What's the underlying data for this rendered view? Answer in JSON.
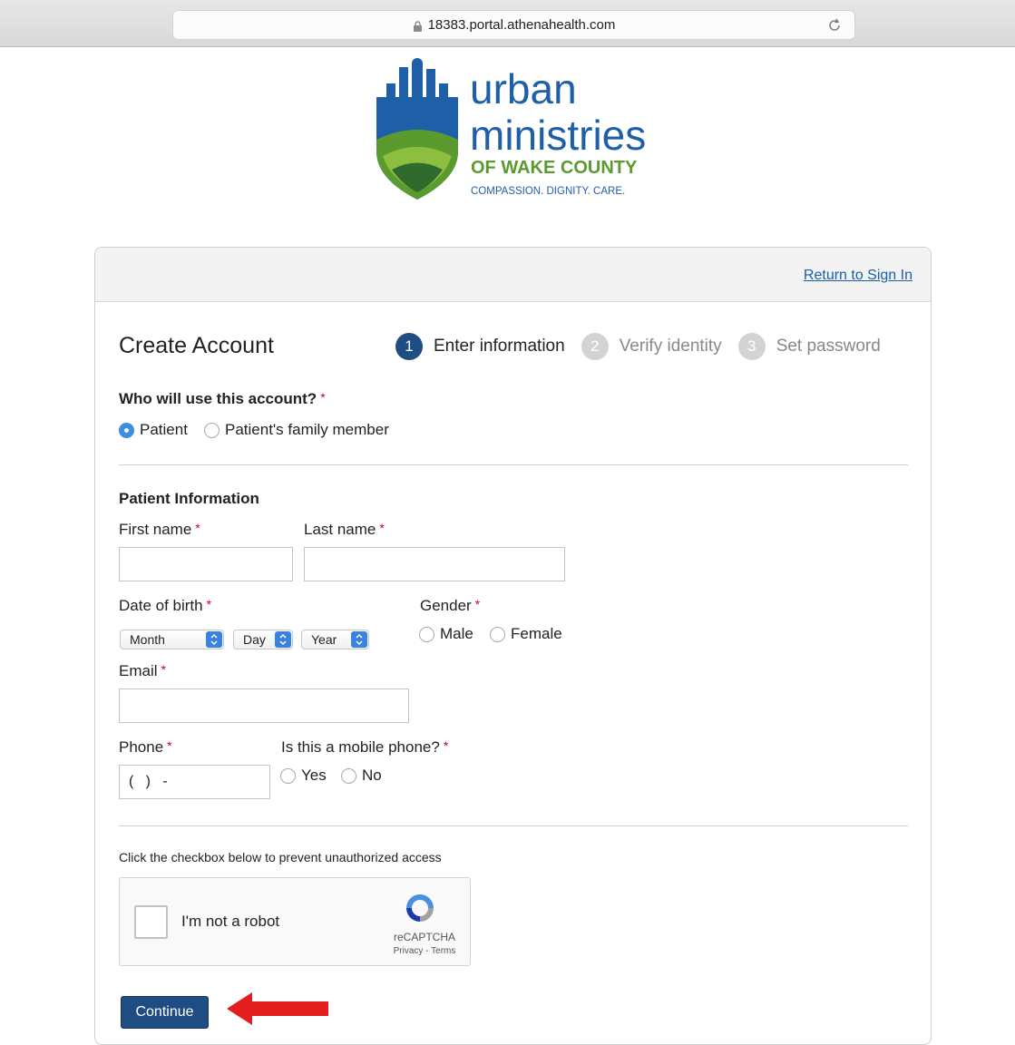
{
  "browser": {
    "url": "18383.portal.athenahealth.com",
    "icons": [
      "lock-icon",
      "reload-icon"
    ]
  },
  "logo": {
    "line1": "urban",
    "line2": "ministries",
    "line3": "OF WAKE COUNTY",
    "tagline": "COMPASSION. DIGNITY. CARE.",
    "colors": {
      "blue": "#1f5fa8",
      "green": "#5a9a2e",
      "darkgreen": "#2f6b2a"
    }
  },
  "header": {
    "return_link": "Return to Sign In"
  },
  "page": {
    "title": "Create Account"
  },
  "steps": [
    {
      "num": "1",
      "label": "Enter information",
      "state": "active"
    },
    {
      "num": "2",
      "label": "Verify identity",
      "state": "inactive"
    },
    {
      "num": "3",
      "label": "Set password",
      "state": "inactive"
    }
  ],
  "account_user": {
    "question": "Who will use this account?",
    "options": [
      "Patient",
      "Patient's family member"
    ],
    "selected": "Patient"
  },
  "patient_info": {
    "heading": "Patient Information",
    "first_name_label": "First name",
    "last_name_label": "Last name",
    "dob_label": "Date of birth",
    "dob_month": "Month",
    "dob_day": "Day",
    "dob_year": "Year",
    "gender_label": "Gender",
    "gender_options": [
      "Male",
      "Female"
    ],
    "email_label": "Email",
    "phone_label": "Phone",
    "phone_value": "(   )   -",
    "mobile_label": "Is this a mobile phone?",
    "mobile_options": [
      "Yes",
      "No"
    ]
  },
  "captcha": {
    "instruction": "Click the checkbox below to prevent unauthorized access",
    "label": "I'm not a robot",
    "brand": "reCAPTCHA",
    "terms": "Privacy - Terms"
  },
  "actions": {
    "continue_label": "Continue"
  },
  "colors": {
    "primary": "#1f4c82",
    "link": "#1a5ea8",
    "required": "#d0021b",
    "annotation_arrow": "#e31e1e"
  }
}
